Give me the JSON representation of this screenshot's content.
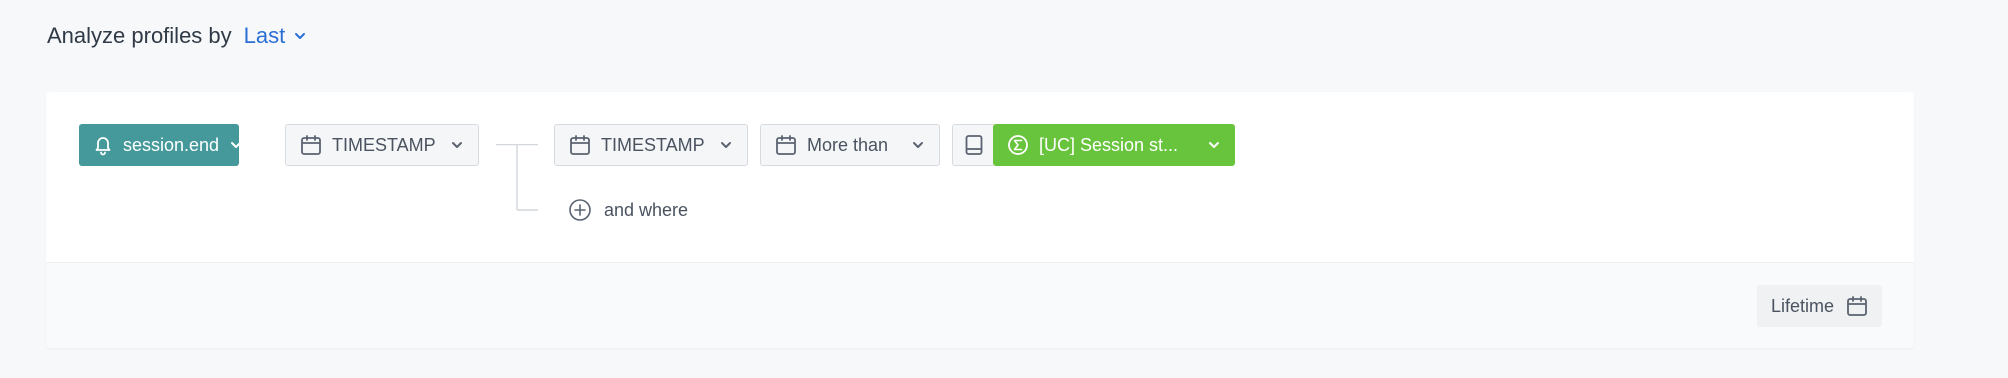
{
  "header": {
    "title": "Analyze profiles by",
    "mode_value": "Last"
  },
  "filters": {
    "event_label": "session.end",
    "event_param_label": "TIMESTAMP",
    "condition_param_label": "TIMESTAMP",
    "operator_label": "More than",
    "aggregate_label": "[UC] Session st...",
    "and_where_label": "and where"
  },
  "footer": {
    "range_label": "Lifetime"
  },
  "colors": {
    "accent_blue": "#2b6fd6",
    "event_teal": "#45999a",
    "aggregate_green": "#68c43c"
  },
  "icons": {
    "event": "bell-icon",
    "date": "calendar-icon",
    "catalog": "book-icon",
    "aggregate": "sigma-circle-icon",
    "add": "plus-circle-icon",
    "dropdown": "chevron-down-icon"
  }
}
